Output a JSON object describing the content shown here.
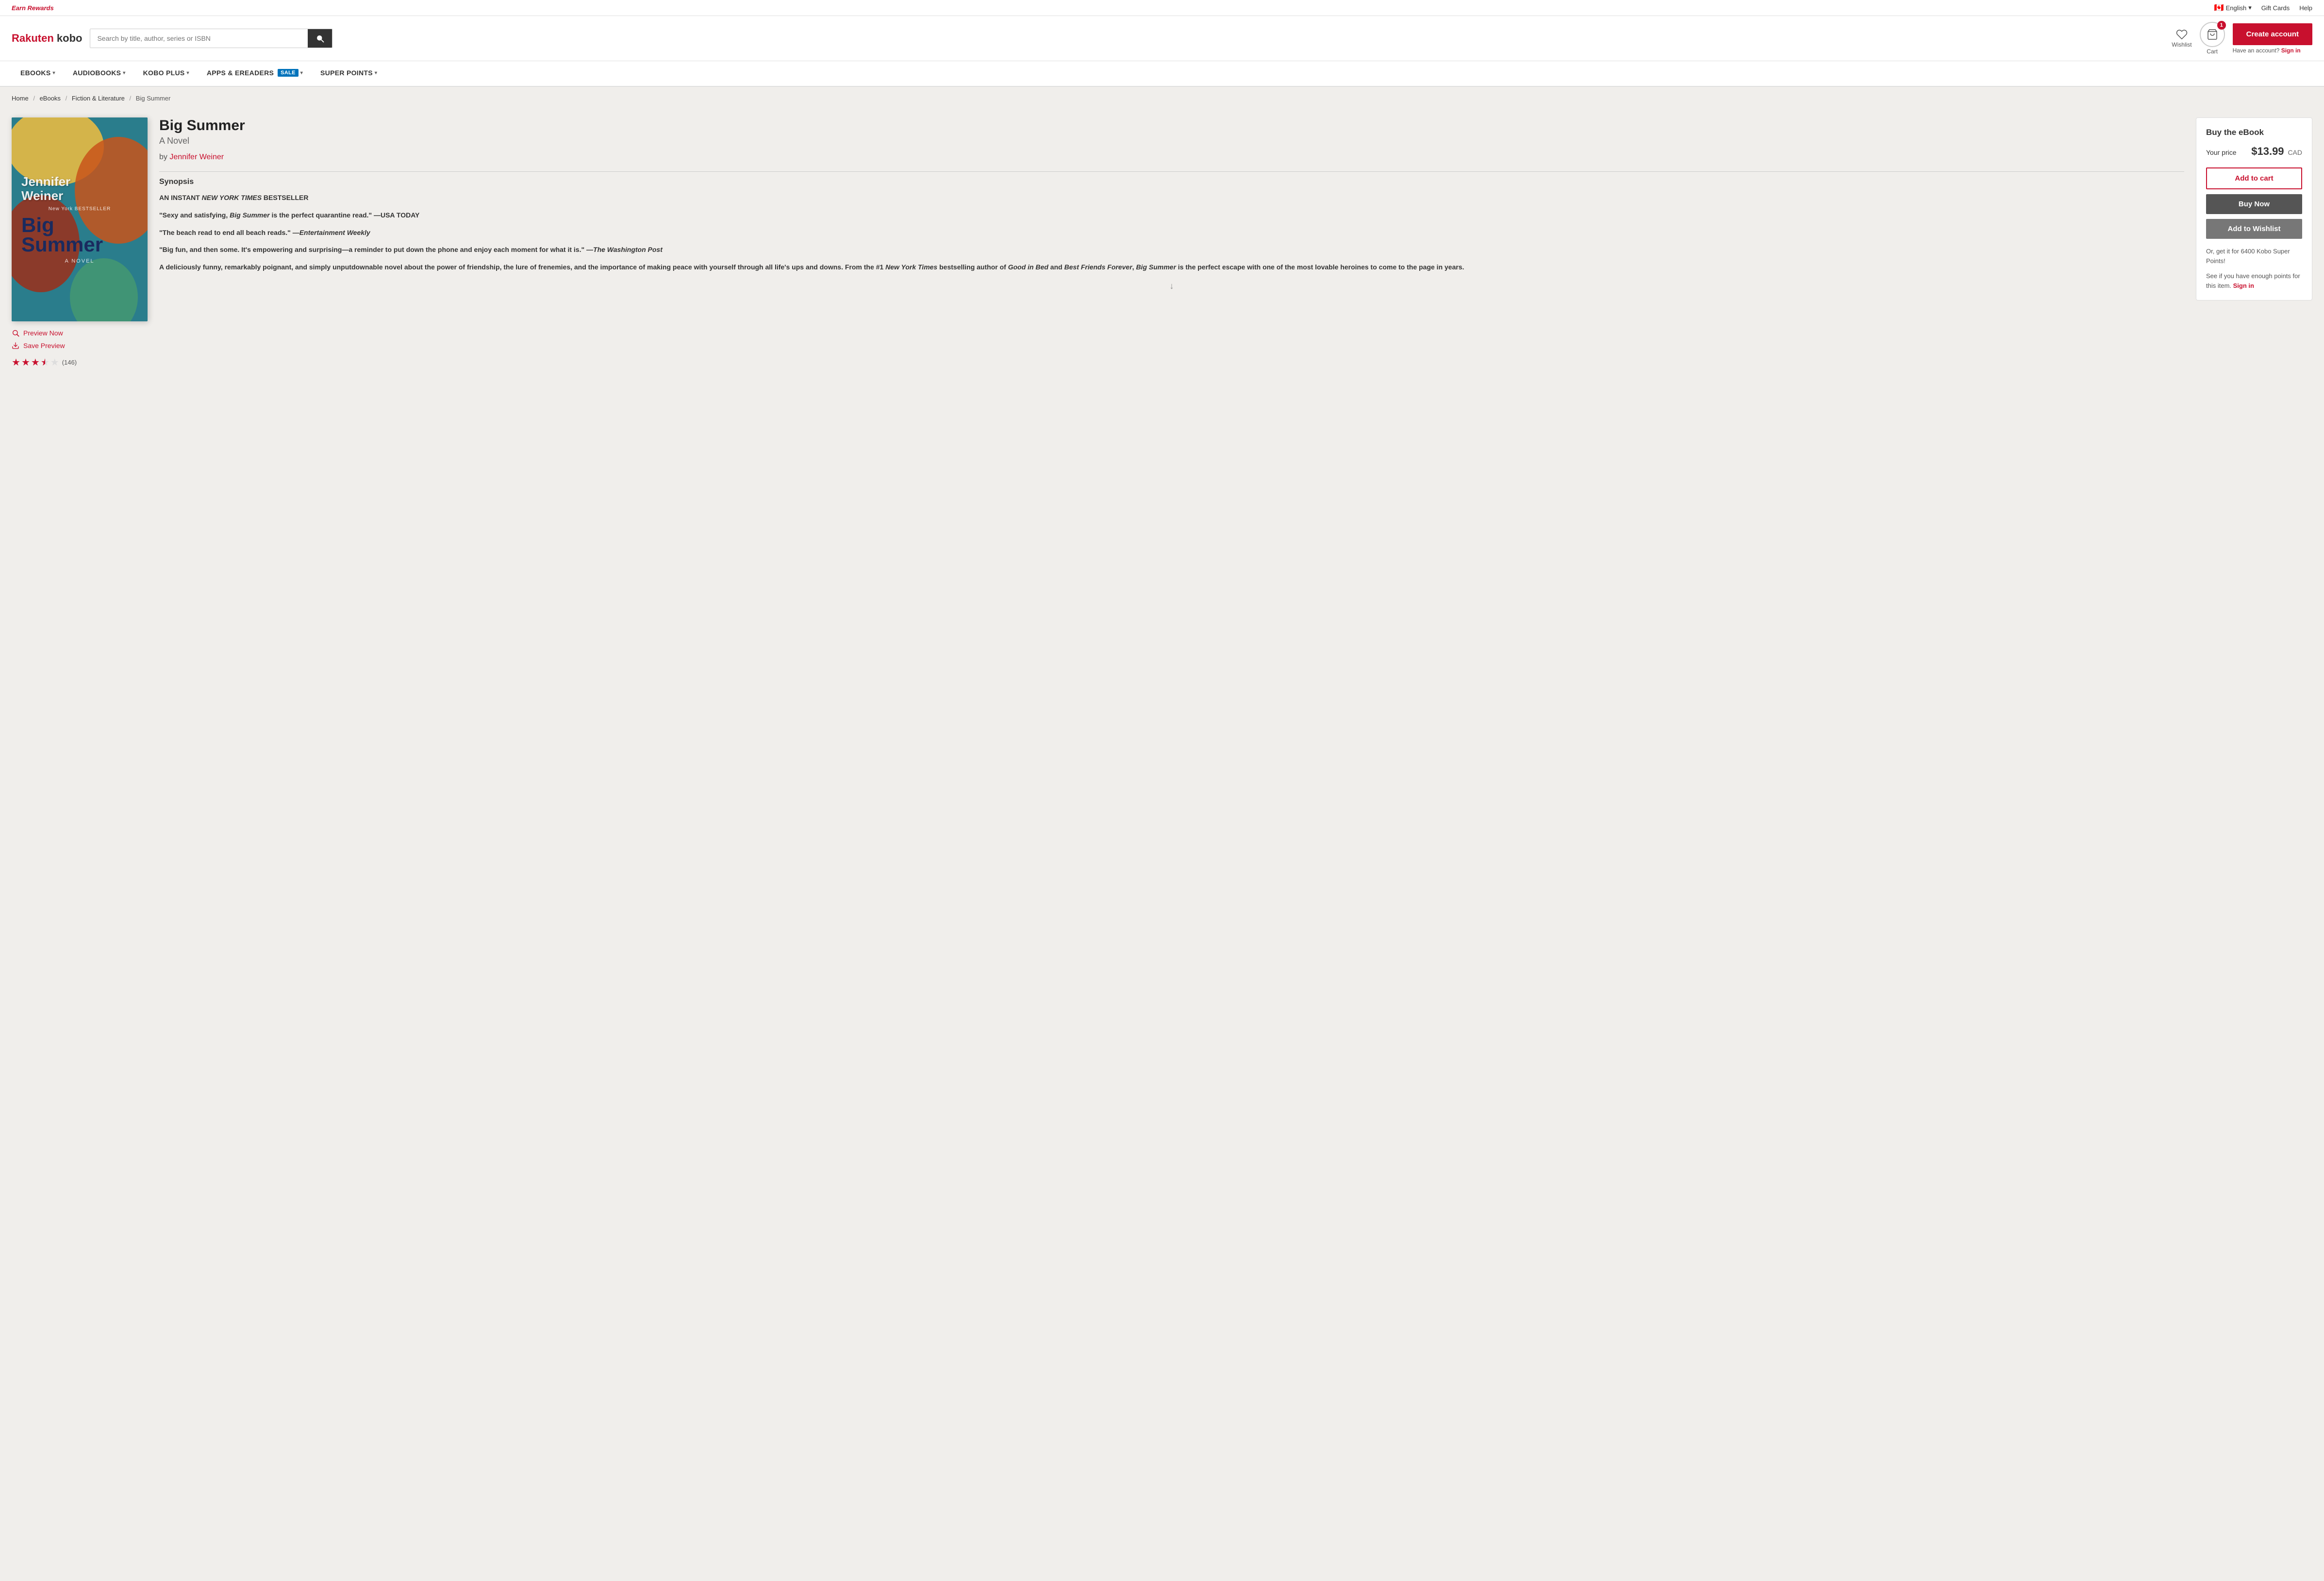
{
  "topbar": {
    "earn_rewards": "Earn Rewards",
    "language": "English",
    "gift_cards": "Gift Cards",
    "help": "Help"
  },
  "header": {
    "logo_rakuten": "Rakuten",
    "logo_kobo": " kobo",
    "search_placeholder": "Search by title, author, series or ISBN",
    "wishlist_label": "Wishlist",
    "cart_label": "Cart",
    "cart_count": "1",
    "create_account": "Create account",
    "have_account": "Have an account?",
    "sign_in": "Sign in"
  },
  "nav": {
    "items": [
      {
        "label": "eBOOKS",
        "has_dropdown": true
      },
      {
        "label": "AUDIOBOOKS",
        "has_dropdown": true
      },
      {
        "label": "KOBO PLUS",
        "has_dropdown": true
      },
      {
        "label": "APPS & eREADERS",
        "has_dropdown": true,
        "badge": "SALE"
      },
      {
        "label": "SUPER POINTS",
        "has_dropdown": true
      }
    ]
  },
  "breadcrumb": {
    "home": "Home",
    "ebooks": "eBooks",
    "fiction": "Fiction & Literature",
    "current": "Big Summer"
  },
  "book": {
    "title": "Big Summer",
    "subtitle": "A Novel",
    "author_prefix": "by",
    "author": "Jennifer Weiner",
    "cover_author": "Jennifer\nWeiner",
    "cover_nyt": "New York BESTSELLER",
    "cover_title": "Big\nSummer",
    "cover_novel": "A NOVEL",
    "synopsis_heading": "Synopsis",
    "synopsis_line1": "AN INSTANT NEW YORK TIMES BESTSELLER",
    "synopsis_quote1": "“Sexy and satisfying, Big Summer is the perfect quarantine read.” —USA TODAY",
    "synopsis_quote2": "“The beach read to end all beach reads.” —Entertainment Weekly",
    "synopsis_quote3": "“Big fun, and then some. It’s empowering and surprising—a reminder to put down the phone and enjoy each moment for what it is.” —The Washington Post",
    "synopsis_body": "A deliciously funny, remarkably poignant, and simply unputdownable novel about the power of friendship, the lure of frenemies, and the importance of making peace with yourself through all life’s ups and downs. From the #1 New York Times bestselling author of Good in Bed and Best Friends Forever, Big Summer is the perfect escape with one of the most lovable heroines to come to the page in years.",
    "preview_label": "Preview Now",
    "save_preview_label": "Save Preview",
    "rating": "3.5",
    "rating_count": "(146)",
    "stars_filled": 3,
    "stars_half": 1,
    "stars_empty": 1
  },
  "buybox": {
    "title": "Buy the eBook",
    "price_label": "Your price",
    "price": "$13.99",
    "currency": "CAD",
    "add_to_cart": "Add to cart",
    "buy_now": "Buy Now",
    "add_wishlist": "Add to Wishlist",
    "kobo_points_text": "Or, get it for 6400 Kobo Super Points!",
    "sign_in_prompt": "See if you have enough points for this item.",
    "sign_in": "Sign in"
  }
}
